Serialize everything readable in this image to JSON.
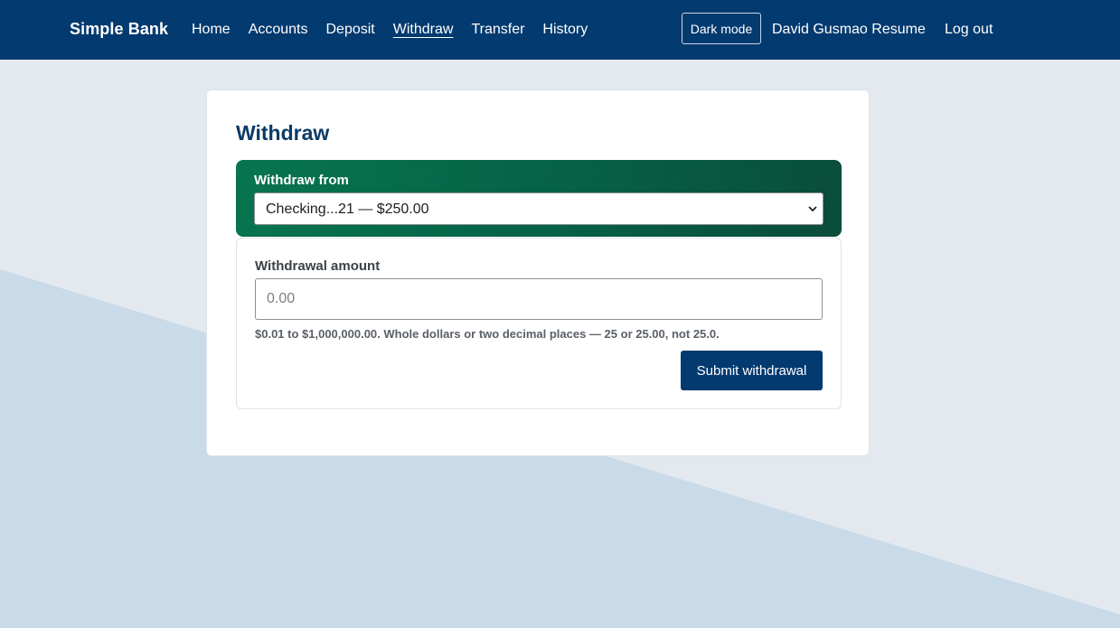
{
  "nav": {
    "brand": "Simple Bank",
    "links": [
      {
        "label": "Home",
        "active": false
      },
      {
        "label": "Accounts",
        "active": false
      },
      {
        "label": "Deposit",
        "active": false
      },
      {
        "label": "Withdraw",
        "active": true
      },
      {
        "label": "Transfer",
        "active": false
      },
      {
        "label": "History",
        "active": false
      }
    ],
    "dark_mode_label": "Dark mode",
    "resume_label": "David Gusmao Resume",
    "logout_label": "Log out"
  },
  "main": {
    "title": "Withdraw",
    "from_label": "Withdraw from",
    "selected_account": "Checking...21 — $250.00",
    "amount_label": "Withdrawal amount",
    "amount_value": "",
    "amount_placeholder": "0.00",
    "amount_hint": "$0.01 to $1,000,000.00. Whole dollars or two decimal places — 25 or 25.00, not 25.0.",
    "submit_label": "Submit withdrawal"
  },
  "colors": {
    "nav_background": "#033a6f",
    "page_background": "#e4e9f0",
    "background_shape": "#c9dae8",
    "from_panel_gradient": [
      "#08754f",
      "#0a4c3a"
    ],
    "primary_button": "#033a6f",
    "title": "#0b3a66"
  },
  "icons": {
    "select_arrow": "chevron-down-icon"
  }
}
